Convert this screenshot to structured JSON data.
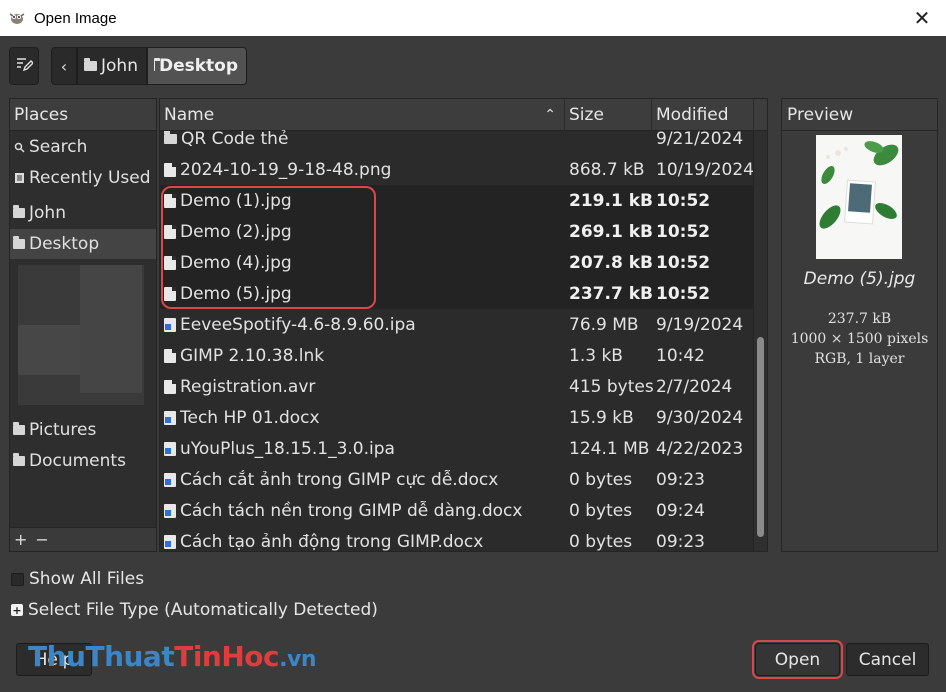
{
  "window": {
    "title": "Open Image",
    "close_glyph": "✕",
    "app_icon": "gimp-icon"
  },
  "toolbar": {
    "edit_icon": "edit-location-icon",
    "back_glyph": "‹",
    "breadcrumbs": [
      "John",
      "Desktop"
    ]
  },
  "places": {
    "header": "Places",
    "items": [
      {
        "label": "Search",
        "icon": "search-icon"
      },
      {
        "label": "Recently Used",
        "icon": "recent-icon"
      },
      {
        "label": "John",
        "icon": "folder-icon"
      },
      {
        "label": "Desktop",
        "icon": "folder-icon",
        "selected": true
      },
      {
        "label": "Pictures",
        "icon": "folder-icon"
      },
      {
        "label": "Documents",
        "icon": "folder-icon"
      }
    ],
    "add_glyph": "+",
    "remove_glyph": "−"
  },
  "file_list": {
    "columns": {
      "name": "Name",
      "size": "Size",
      "modified": "Modified"
    },
    "sort_glyph": "⌃",
    "rows": [
      {
        "name": "QR Code thẻ",
        "size": "",
        "modified": "9/21/2024",
        "icon": "folder"
      },
      {
        "name": "2024-10-19_9-18-48.png",
        "size": "868.7 kB",
        "modified": "10/19/2024",
        "icon": "doc"
      },
      {
        "name": "Demo (1).jpg",
        "size": "219.1 kB",
        "modified": "10:52",
        "icon": "doc",
        "selected": true
      },
      {
        "name": "Demo (2).jpg",
        "size": "269.1 kB",
        "modified": "10:52",
        "icon": "doc",
        "selected": true
      },
      {
        "name": "Demo (4).jpg",
        "size": "207.8 kB",
        "modified": "10:52",
        "icon": "doc",
        "selected": true
      },
      {
        "name": "Demo (5).jpg",
        "size": "237.7 kB",
        "modified": "10:52",
        "icon": "doc",
        "selected": true
      },
      {
        "name": "EeveeSpotify-4.6-8.9.60.ipa",
        "size": "76.9 MB",
        "modified": "9/19/2024",
        "icon": "word"
      },
      {
        "name": "GIMP 2.10.38.lnk",
        "size": "1.3 kB",
        "modified": "10:42",
        "icon": "doc"
      },
      {
        "name": "Registration.avr",
        "size": "415 bytes",
        "modified": "2/7/2024",
        "icon": "doc"
      },
      {
        "name": "Tech HP 01.docx",
        "size": "15.9 kB",
        "modified": "9/30/2024",
        "icon": "word"
      },
      {
        "name": "uYouPlus_18.15.1_3.0.ipa",
        "size": "124.1 MB",
        "modified": "4/22/2023",
        "icon": "word"
      },
      {
        "name": "Cách cắt ảnh trong GIMP cực dễ.docx",
        "size": "0 bytes",
        "modified": "09:23",
        "icon": "word"
      },
      {
        "name": "Cách tách nền trong GIMP dễ dàng.docx",
        "size": "0 bytes",
        "modified": "09:24",
        "icon": "word"
      },
      {
        "name": "Cách tạo ảnh động trong GIMP.docx",
        "size": "0 bytes",
        "modified": "09:23",
        "icon": "word"
      }
    ]
  },
  "preview": {
    "header": "Preview",
    "file_name": "Demo (5).jpg",
    "file_size": "237.7 kB",
    "dimensions": "1000 × 1500 pixels",
    "color_info": "RGB, 1 layer"
  },
  "options": {
    "show_all_files": "Show All Files",
    "select_file_type": "Select File Type (Automatically Detected)"
  },
  "buttons": {
    "help": "Help",
    "open": "Open",
    "cancel": "Cancel"
  },
  "watermark": {
    "part1": "Thu",
    "part2": "Thuat",
    "part3": "Tin",
    "part4": "Hoc",
    "part5": ".vn"
  }
}
